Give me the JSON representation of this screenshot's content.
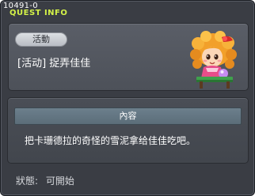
{
  "window": {
    "quest_id": "10491-0",
    "title": "QUEST INFO"
  },
  "quest": {
    "category": "活動",
    "name": "[活动] 捉弄佳佳",
    "npc_icon": "npc-girl-portrait-icon"
  },
  "content": {
    "header": "內容",
    "description": "把卡珊德拉的奇怪的雪泥拿给佳佳吃吧。"
  },
  "status": {
    "label": "狀態:",
    "value": "可開始"
  },
  "colors": {
    "title": "#d4f248",
    "background": "#3a3d44",
    "header_bar": "#6c7f8c"
  }
}
